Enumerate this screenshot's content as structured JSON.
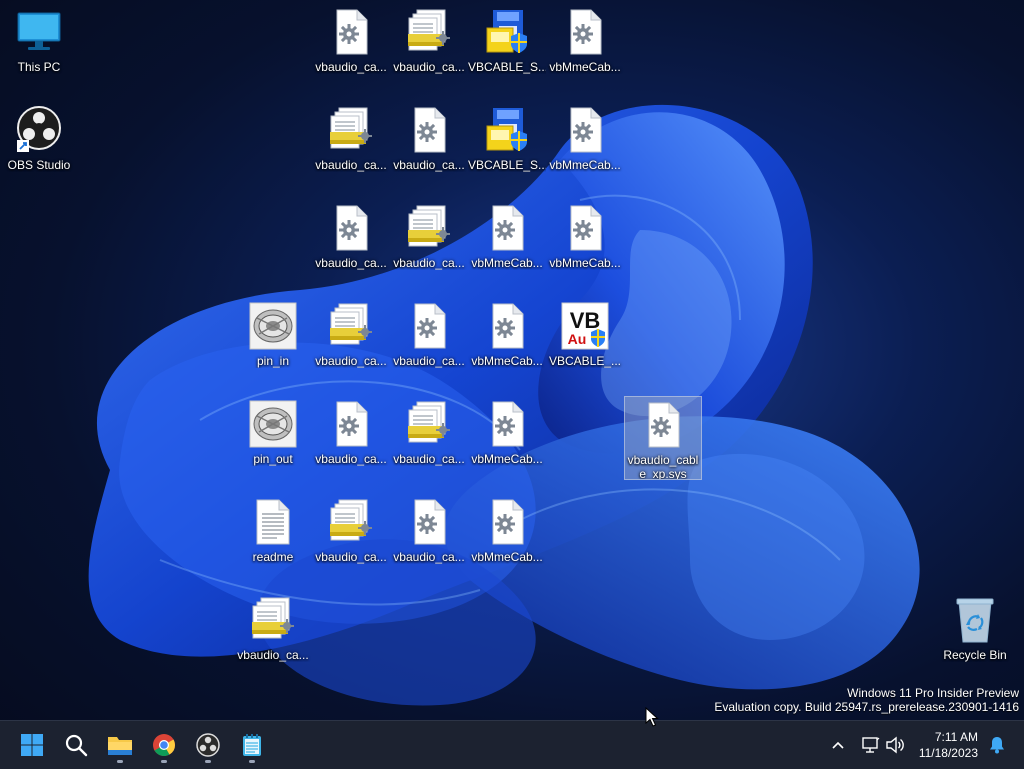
{
  "desktop": {
    "icons": [
      {
        "label": "This PC",
        "type": "monitor"
      },
      {
        "label": "OBS Studio",
        "type": "obs"
      },
      {
        "label": "vbaudio_ca...",
        "type": "gear-doc"
      },
      {
        "label": "vbaudio_ca...",
        "type": "stack"
      },
      {
        "label": "VBCABLE_S...",
        "type": "setup"
      },
      {
        "label": "vbMmeCab...",
        "type": "gear-doc"
      },
      {
        "label": "vbaudio_ca...",
        "type": "stack"
      },
      {
        "label": "vbaudio_ca...",
        "type": "gear-doc"
      },
      {
        "label": "VBCABLE_S...",
        "type": "setup"
      },
      {
        "label": "vbMmeCab...",
        "type": "gear-doc"
      },
      {
        "label": "vbaudio_ca...",
        "type": "gear-doc"
      },
      {
        "label": "vbaudio_ca...",
        "type": "stack"
      },
      {
        "label": "vbMmeCab...",
        "type": "gear-doc"
      },
      {
        "label": "vbMmeCab...",
        "type": "gear-doc"
      },
      {
        "label": "pin_in",
        "type": "pin"
      },
      {
        "label": "vbaudio_ca...",
        "type": "stack"
      },
      {
        "label": "vbaudio_ca...",
        "type": "gear-doc"
      },
      {
        "label": "vbMmeCab...",
        "type": "gear-doc"
      },
      {
        "label": "VBCABLE_...",
        "type": "vb"
      },
      {
        "label": "pin_out",
        "type": "pin"
      },
      {
        "label": "vbaudio_ca...",
        "type": "gear-doc"
      },
      {
        "label": "vbaudio_ca...",
        "type": "stack"
      },
      {
        "label": "vbMmeCab...",
        "type": "gear-doc"
      },
      {
        "label": "vbaudio_cable_xp.sys",
        "type": "gear-doc"
      },
      {
        "label": "readme",
        "type": "text"
      },
      {
        "label": "vbaudio_ca...",
        "type": "stack"
      },
      {
        "label": "vbaudio_ca...",
        "type": "gear-doc"
      },
      {
        "label": "vbMmeCab...",
        "type": "gear-doc"
      },
      {
        "label": "vbaudio_ca...",
        "type": "stack"
      },
      {
        "label": "Recycle Bin",
        "type": "recycle"
      }
    ],
    "vb_logo_text": "VB",
    "vb_logo_sub": "Au"
  },
  "watermark": {
    "line1": "Windows 11 Pro Insider Preview",
    "line2": "Evaluation copy. Build 25947.rs_prerelease.230901-1416"
  },
  "taskbar": {
    "apps": [
      {
        "name": "start-button",
        "icon": "windows-logo-icon"
      },
      {
        "name": "search-button",
        "icon": "search-icon"
      },
      {
        "name": "file-explorer-button",
        "icon": "folder-icon"
      },
      {
        "name": "chrome-button",
        "icon": "chrome-icon"
      },
      {
        "name": "obs-button",
        "icon": "obs-icon"
      },
      {
        "name": "notepad-button",
        "icon": "notepad-icon"
      }
    ],
    "clock": {
      "time": "7:11 AM",
      "date": "11/18/2023"
    }
  },
  "colors": {
    "accent": "#0a5fd8",
    "taskbar": "#1c2230"
  }
}
